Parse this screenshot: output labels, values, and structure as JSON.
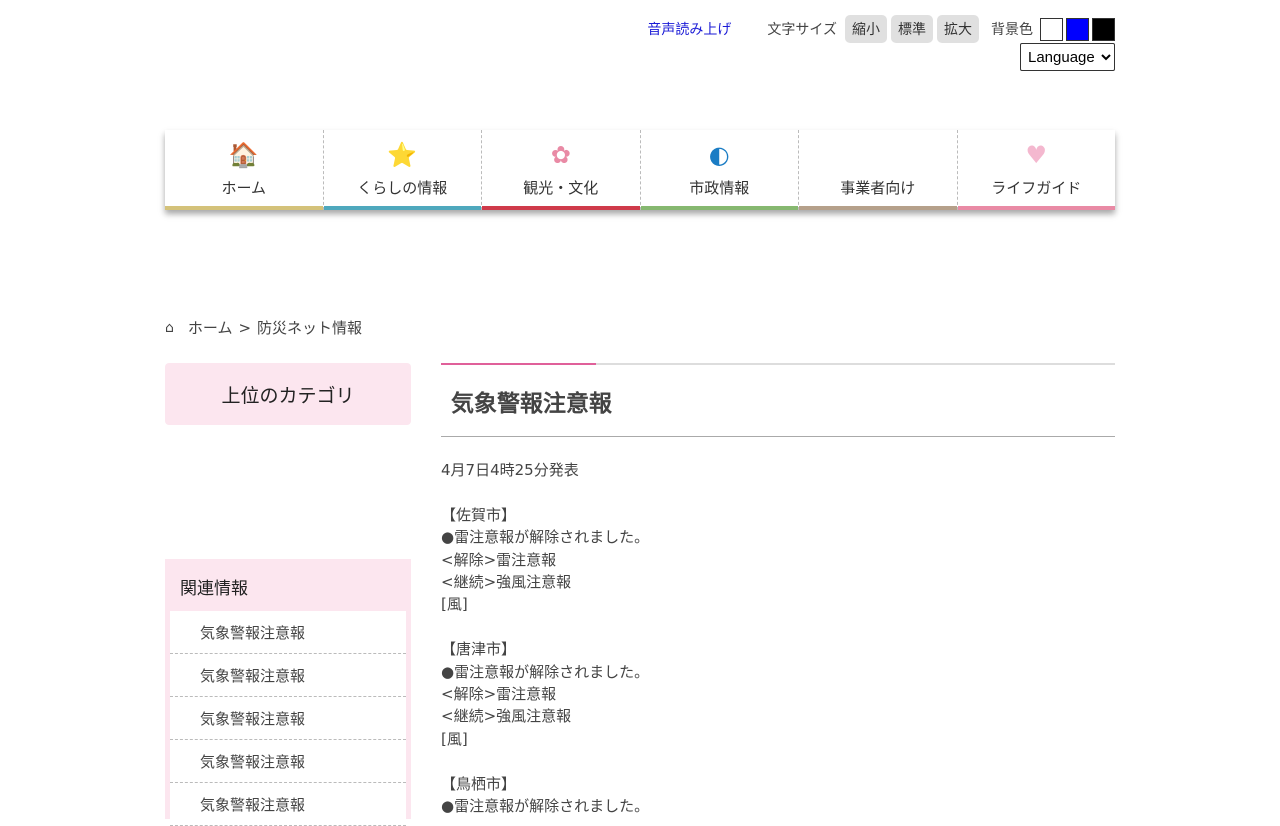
{
  "utility": {
    "read_aloud": "音声読み上げ",
    "font_size_label": "文字サイズ",
    "font_buttons": [
      "縮小",
      "標準",
      "拡大"
    ],
    "bg_label": "背景色",
    "bg_colors": [
      "#ffffff",
      "#0000ff",
      "#000000"
    ],
    "language": "Language"
  },
  "nav": [
    {
      "label": "ホーム",
      "icon": "house-icon",
      "color": "#d4c27a"
    },
    {
      "label": "くらしの情報",
      "icon": "star-icon",
      "color": "#4ea8bd"
    },
    {
      "label": "観光・文化",
      "icon": "sakura-icon",
      "color": "#cf3a4a"
    },
    {
      "label": "市政情報",
      "icon": "city-emblem-icon",
      "color": "#86b870"
    },
    {
      "label": "事業者向け",
      "icon": "",
      "color": "#b5a08a"
    },
    {
      "label": "ライフガイド",
      "icon": "heart-icon",
      "color": "#e98aa5"
    }
  ],
  "breadcrumb": {
    "home": "ホーム",
    "sep": ">",
    "current": "防災ネット情報"
  },
  "sidebar": {
    "category": "上位のカテゴリ",
    "related_title": "関連情報",
    "related": [
      "気象警報注意報",
      "気象警報注意報",
      "気象警報注意報",
      "気象警報注意報",
      "気象警報注意報"
    ]
  },
  "main": {
    "title": "気象警報注意報",
    "body": "4月7日4時25分発表\n\n【佐賀市】\n●雷注意報が解除されました。\n<解除>雷注意報\n<継続>強風注意報\n[風]\n\n【唐津市】\n●雷注意報が解除されました。\n<解除>雷注意報\n<継続>強風注意報\n[風]\n\n【鳥栖市】\n●雷注意報が解除されました。"
  }
}
